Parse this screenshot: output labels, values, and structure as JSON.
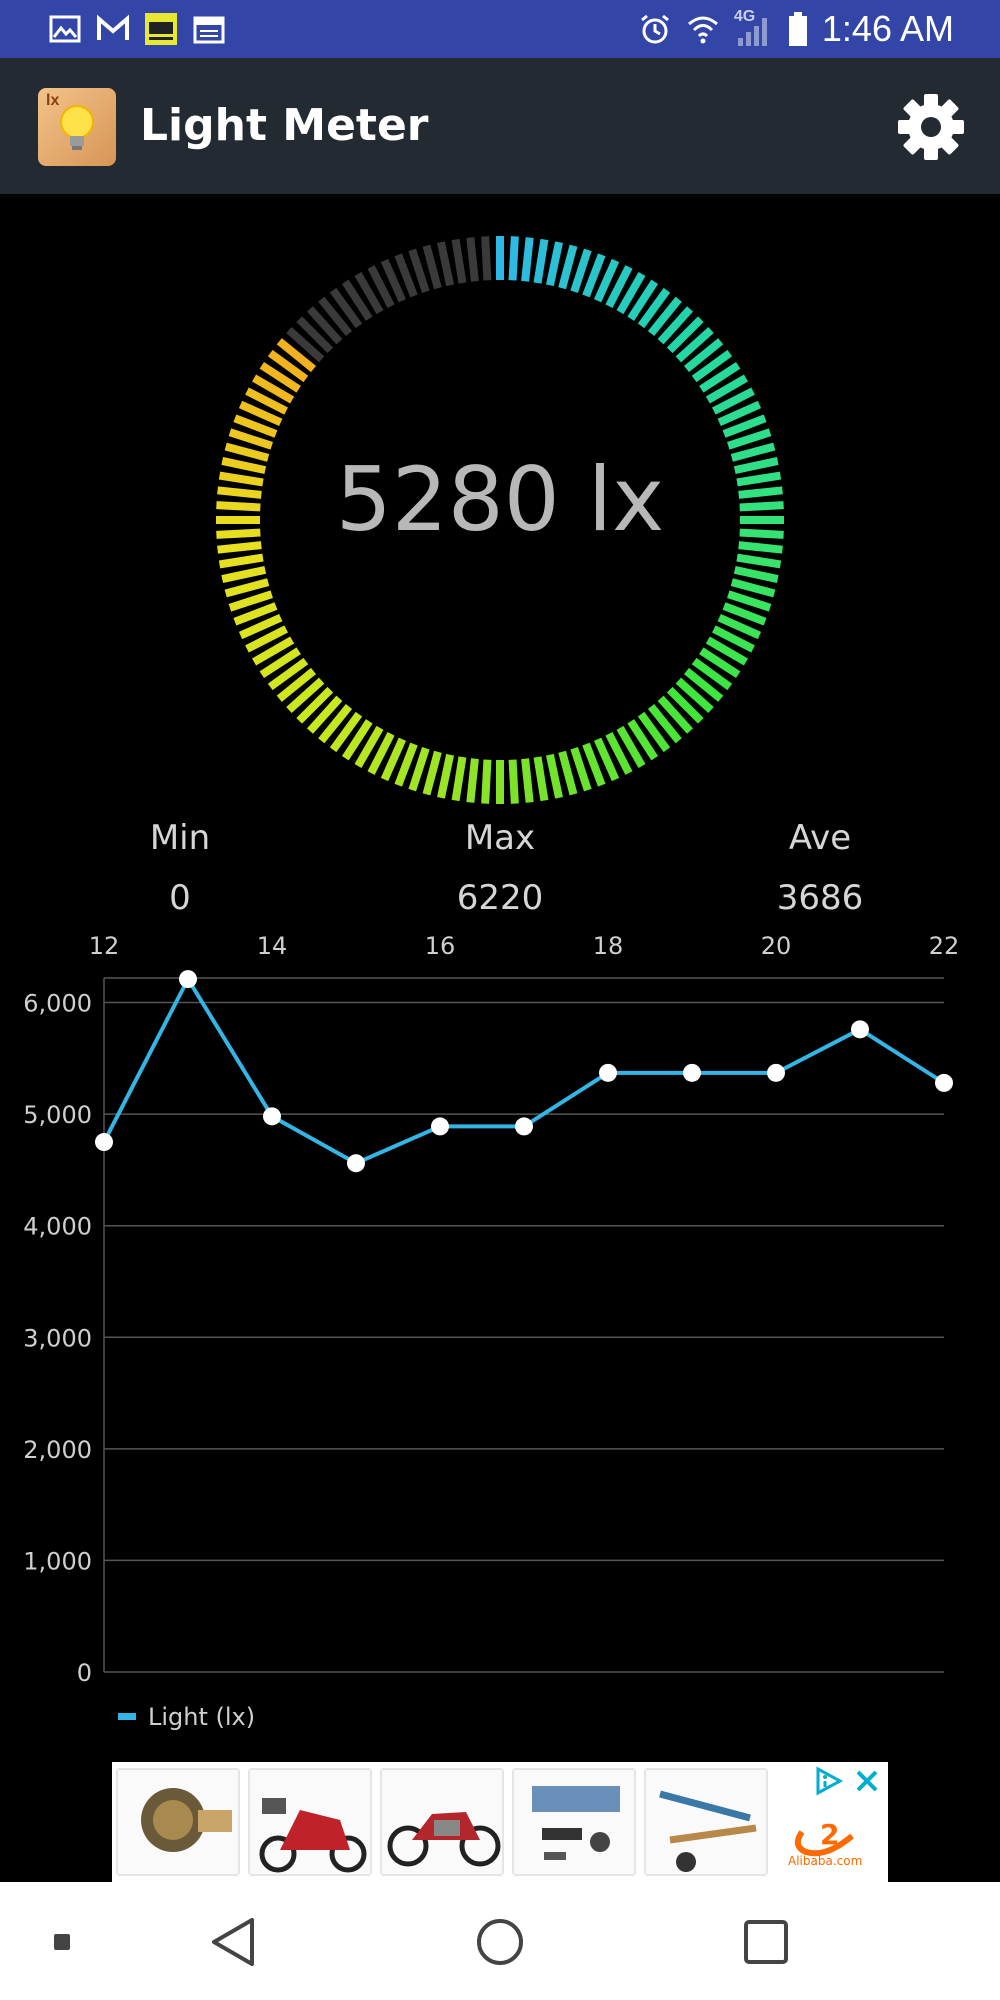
{
  "status_bar": {
    "time": "1:46 AM",
    "network": "4G",
    "icons_left": [
      "image-icon",
      "gmail-icon",
      "straight-talk-icon",
      "calendar-icon"
    ],
    "icons_right": [
      "alarm-icon",
      "wifi-icon",
      "signal-icon",
      "battery-icon"
    ]
  },
  "app_bar": {
    "app_icon_badge": "lx",
    "title": "Light Meter",
    "settings_icon": "gear-icon"
  },
  "gauge": {
    "value": 5280,
    "display": "5280 lx",
    "colors": {
      "inactive": "#3a3a3a",
      "gradient": [
        "#2fb8e6",
        "#22d6a8",
        "#34e27a",
        "#3fe63a",
        "#7fe22a",
        "#c8e81e",
        "#e8e020",
        "#f2b01e"
      ]
    }
  },
  "stats": {
    "min": {
      "label": "Min",
      "value": "0"
    },
    "max": {
      "label": "Max",
      "value": "6220"
    },
    "ave": {
      "label": "Ave",
      "value": "3686"
    }
  },
  "chart_data": {
    "type": "line",
    "x_ticks": [
      "12",
      "14",
      "16",
      "18",
      "20",
      "22"
    ],
    "y_ticks": [
      "0",
      "1,000",
      "2,000",
      "3,000",
      "4,000",
      "5,000",
      "6,000"
    ],
    "x": [
      12,
      13,
      14,
      15,
      16,
      17,
      18,
      19,
      20,
      21,
      22
    ],
    "series": [
      {
        "name": "Light  (lx)",
        "color": "#33b5e5",
        "values": [
          4750,
          6210,
          4980,
          4560,
          4890,
          4890,
          5370,
          5370,
          5370,
          5760,
          5280
        ]
      }
    ],
    "xlim": [
      12,
      22
    ],
    "ylim": [
      0,
      6220
    ],
    "grid": true,
    "legend": "bottom-left"
  },
  "ad": {
    "tiles": [
      "oil-pressure-switch",
      "electric-scooter",
      "motorcycle",
      "tool-kit",
      "dental-tools"
    ],
    "brand": "Alibaba.com",
    "adchoices_icon": "adchoices-icon",
    "close_icon": "close-icon"
  },
  "nav_bar": {
    "buttons": [
      "dot-button",
      "back-button",
      "home-button",
      "recents-button"
    ]
  }
}
